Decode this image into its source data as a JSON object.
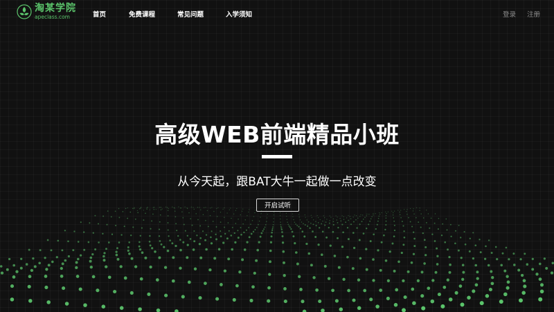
{
  "brand": {
    "name_cn": "淘某学院",
    "domain": "apeclass.com",
    "accent_color": "#5bc46b",
    "logo_icon": "leaf-logo-icon"
  },
  "nav": {
    "items": [
      {
        "label": "首页"
      },
      {
        "label": "免费课程"
      },
      {
        "label": "常见问题"
      },
      {
        "label": "入学须知"
      }
    ]
  },
  "auth": {
    "login": "登录",
    "register": "注册"
  },
  "hero": {
    "title": "高级WEB前端精品小班",
    "subtitle": "从今天起，跟BAT大牛一起做一点改变",
    "cta": "开启试听",
    "background_pattern": "green-dot-wave-particles"
  }
}
